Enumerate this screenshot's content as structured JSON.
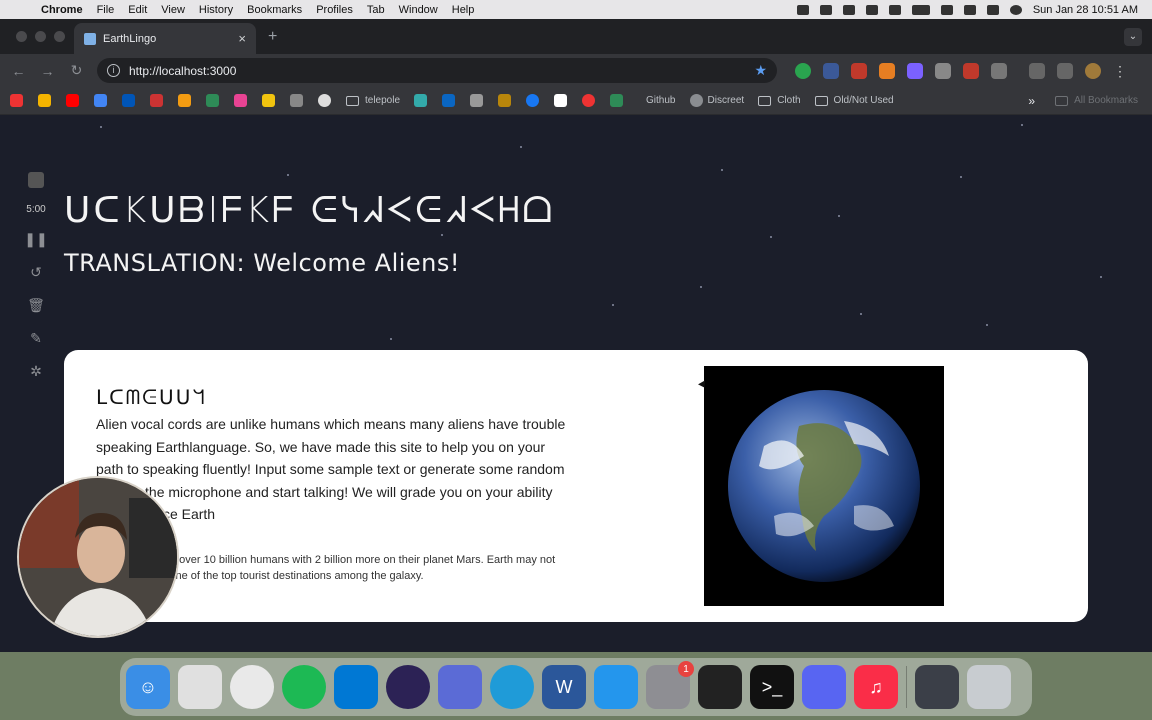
{
  "menubar": {
    "app": "Chrome",
    "items": [
      "File",
      "Edit",
      "View",
      "History",
      "Bookmarks",
      "Profiles",
      "Tab",
      "Window",
      "Help"
    ],
    "clock": "Sun Jan 28  10:51 AM"
  },
  "tab": {
    "title": "EarthLingo",
    "close": "×"
  },
  "new_tab": "+",
  "address": {
    "url": "http://localhost:3000"
  },
  "bookmarks": {
    "telepole": "telepole",
    "github": "Github",
    "discreet": "Discreet",
    "cloth": "Cloth",
    "old": "Old/Not Used",
    "all": "All Bookmarks"
  },
  "page": {
    "alien_title": "ᑌᑕKᑌᗷIᖴKᖴ ᕮᓭᖽᐸᕮᖽᐸᕼᗝ",
    "translation": "TRANSLATION: Welcome Aliens!",
    "card": {
      "alien_heading": "ᒪᑕᗰᕮᑌᑌᖻ",
      "paragraph": "Alien vocal cords are unlike humans which means many aliens have trouble speaking Earthlanguage. So, we have made this site to help you on your path to speaking fluently! Input some sample text or generate some random text, hit the microphone and start talking! We will grade you on your ability to pronounce Earth",
      "note": "Earth is home to over 10 billion humans with 2 billion more on their planet Mars. Earth may not be alive, but is one of the top tourist destinations among the galaxy."
    }
  },
  "sidebar": {
    "timer": "5:00"
  },
  "dock": {
    "apps": [
      "finder-icon",
      "launchpad-icon",
      "chrome-icon",
      "spotify-icon",
      "vscode-icon",
      "eclipse-icon",
      "tableplus-icon",
      "edge-icon",
      "word-icon",
      "docker-icon",
      "settings-icon",
      "activity-monitor-icon",
      "terminal-icon",
      "discord-icon",
      "music-icon",
      "preview-icon",
      "trash-icon"
    ],
    "settings_badge": "1"
  }
}
